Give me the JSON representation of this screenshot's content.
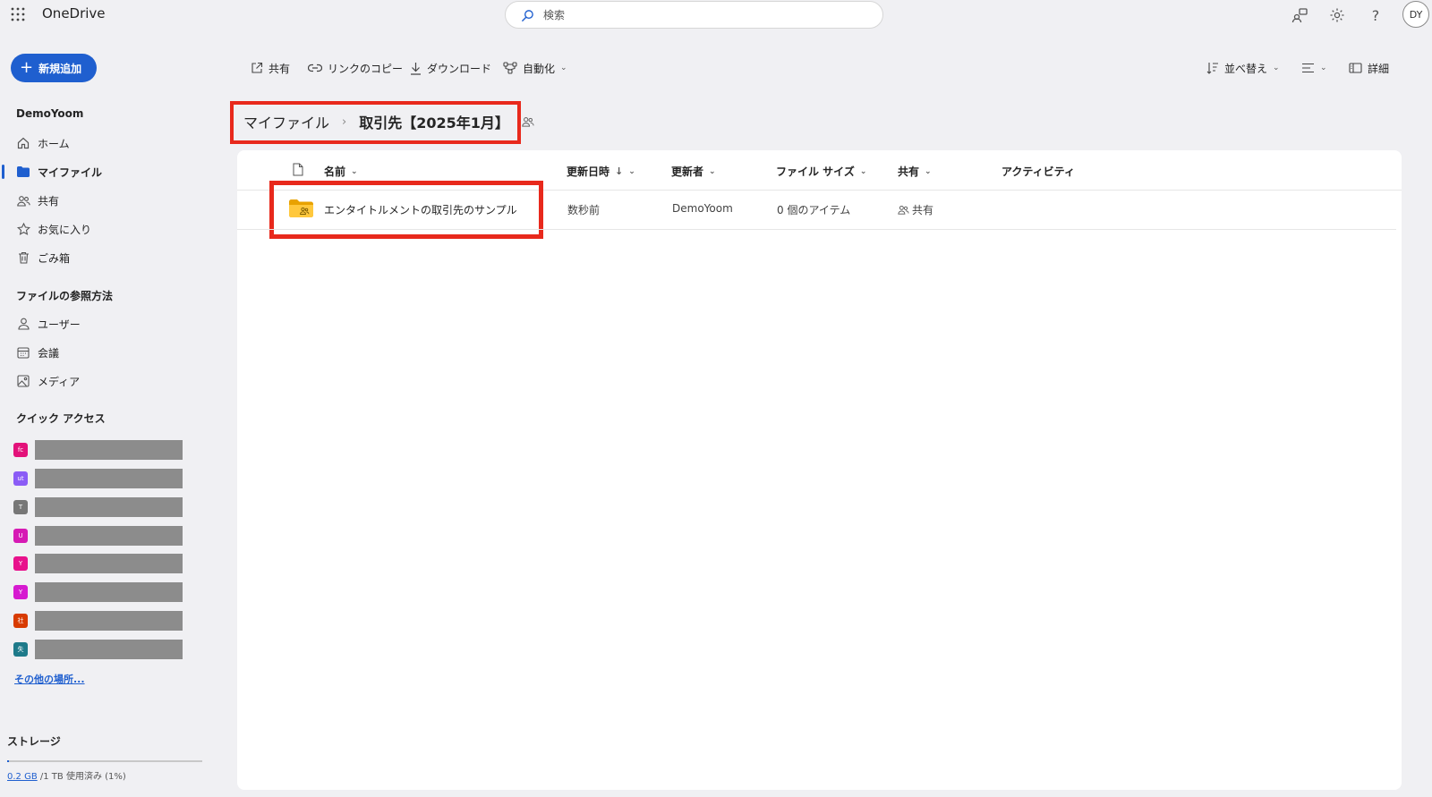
{
  "app": {
    "title": "OneDrive"
  },
  "search": {
    "placeholder": "検索"
  },
  "user": {
    "initials": "DY"
  },
  "new_button": {
    "label": "新規追加"
  },
  "sidebar": {
    "account": "DemoYoom",
    "items": [
      {
        "label": "ホーム",
        "icon": "home-icon"
      },
      {
        "label": "マイファイル",
        "icon": "folder-icon",
        "active": true
      },
      {
        "label": "共有",
        "icon": "people-icon"
      },
      {
        "label": "お気に入り",
        "icon": "star-icon"
      },
      {
        "label": "ごみ箱",
        "icon": "trash-icon"
      }
    ],
    "browse_heading": "ファイルの参照方法",
    "browse_items": [
      {
        "label": "ユーザー",
        "icon": "person-icon"
      },
      {
        "label": "会議",
        "icon": "calendar-icon"
      },
      {
        "label": "メディア",
        "icon": "image-icon"
      }
    ],
    "quick_access_heading": "クイック アクセス",
    "quick_access": [
      {
        "color": "#e3127a",
        "initial": "fc"
      },
      {
        "color": "#8b5cf6",
        "initial": "ut"
      },
      {
        "color": "#777777",
        "initial": "T"
      },
      {
        "color": "#d61ab4",
        "initial": "U"
      },
      {
        "color": "#e8128c",
        "initial": "Y"
      },
      {
        "color": "#d61ad0",
        "initial": "Y"
      },
      {
        "color": "#d83b01",
        "initial": "社"
      },
      {
        "color": "#1e7a8a",
        "initial": "失"
      }
    ],
    "other_places_link": "その他の場所...",
    "storage_heading": "ストレージ",
    "storage_used": "0.2 GB",
    "storage_rest": " /1 TB 使用済み (1%)",
    "storage_fraction": 0.01
  },
  "toolbar": {
    "share": "共有",
    "copy_link": "リンクのコピー",
    "download": "ダウンロード",
    "automate": "自動化",
    "sort": "並べ替え",
    "details": "詳細"
  },
  "breadcrumb": {
    "root": "マイファイル",
    "current": "取引先【2025年1月】"
  },
  "columns": {
    "name": "名前",
    "modified": "更新日時",
    "modified_by": "更新者",
    "size": "ファイル サイズ",
    "sharing": "共有",
    "activity": "アクティビティ"
  },
  "rows": [
    {
      "name": "エンタイトルメントの取引先のサンプル",
      "modified": "数秒前",
      "modified_by": "DemoYoom",
      "size": "0 個のアイテム",
      "sharing": "共有"
    }
  ]
}
